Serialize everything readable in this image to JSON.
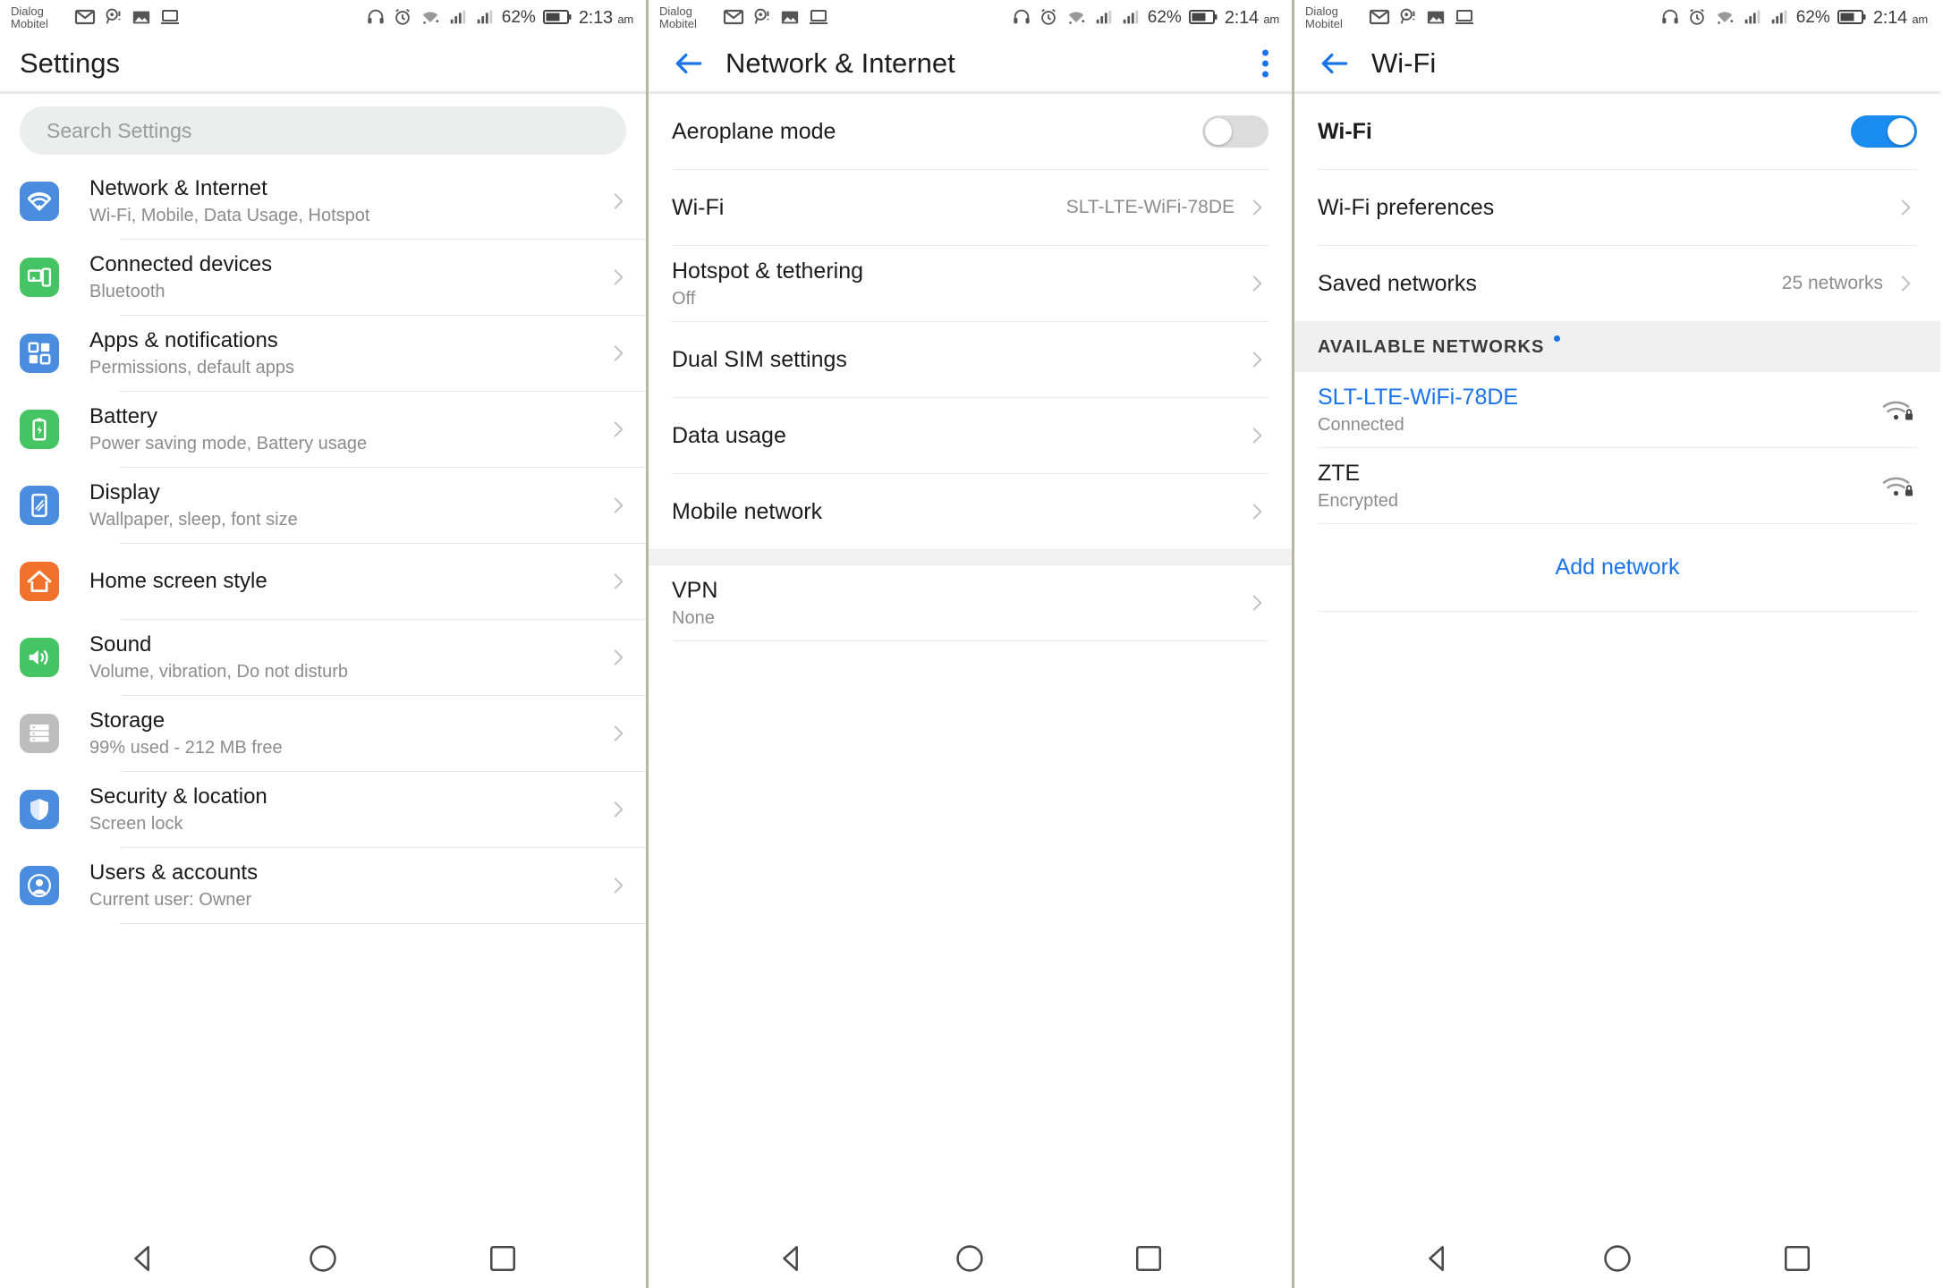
{
  "statusbar": {
    "carrier_line1": "Dialog",
    "carrier_line2": "Mobitel",
    "left_icons": [
      "gmail-icon",
      "location-alert-icon",
      "image-icon",
      "laptop-icon"
    ],
    "right_icons": [
      "headset-icon",
      "alarm-icon",
      "wifi-icon",
      "signal-sim1-icon",
      "signal-sim2-icon"
    ],
    "battery_percent": "62%",
    "time_panel1": "2:13",
    "time_panel2": "2:14",
    "time_panel3": "2:14",
    "meridiem": "am"
  },
  "panel1": {
    "title": "Settings",
    "search": {
      "placeholder": "Search Settings"
    },
    "items": [
      {
        "title": "Network & Internet",
        "subtitle": "Wi-Fi, Mobile, Data Usage, Hotspot",
        "icon": "wifi-icon",
        "color": "#4a8cde"
      },
      {
        "title": "Connected devices",
        "subtitle": "Bluetooth",
        "icon": "devices-icon",
        "color": "#45c463"
      },
      {
        "title": "Apps & notifications",
        "subtitle": "Permissions, default apps",
        "icon": "apps-icon",
        "color": "#4a8cde"
      },
      {
        "title": "Battery",
        "subtitle": "Power saving mode, Battery usage",
        "icon": "battery-icon",
        "color": "#45c463"
      },
      {
        "title": "Display",
        "subtitle": "Wallpaper, sleep, font size",
        "icon": "display-icon",
        "color": "#4a8cde"
      },
      {
        "title": "Home screen style",
        "subtitle": "",
        "icon": "home-icon",
        "color": "#f2712a"
      },
      {
        "title": "Sound",
        "subtitle": "Volume, vibration, Do not disturb",
        "icon": "sound-icon",
        "color": "#45c463"
      },
      {
        "title": "Storage",
        "subtitle": "99% used - 212 MB free",
        "icon": "storage-icon",
        "color": "#bdbdbd"
      },
      {
        "title": "Security & location",
        "subtitle": "Screen lock",
        "icon": "shield-icon",
        "color": "#4a8cde"
      },
      {
        "title": "Users & accounts",
        "subtitle": "Current user: Owner",
        "icon": "person-icon",
        "color": "#4a8cde"
      }
    ]
  },
  "panel2": {
    "title": "Network & Internet",
    "back_icon": "back-arrow-icon",
    "overflow_icon": "overflow-menu-icon",
    "group1": [
      {
        "title": "Aeroplane mode",
        "subtitle": "",
        "value": "",
        "toggle": "off",
        "chevron": false
      },
      {
        "title": "Wi-Fi",
        "subtitle": "",
        "value": "SLT-LTE-WiFi-78DE",
        "chevron": true
      },
      {
        "title": "Hotspot & tethering",
        "subtitle": "Off",
        "value": "",
        "chevron": true
      },
      {
        "title": "Dual SIM settings",
        "subtitle": "",
        "value": "",
        "chevron": true
      },
      {
        "title": "Data usage",
        "subtitle": "",
        "value": "",
        "chevron": true
      },
      {
        "title": "Mobile network",
        "subtitle": "",
        "value": "",
        "chevron": true
      }
    ],
    "group2": [
      {
        "title": "VPN",
        "subtitle": "None",
        "value": "",
        "chevron": true
      }
    ]
  },
  "panel3": {
    "title": "Wi-Fi",
    "back_icon": "back-arrow-icon",
    "group1": [
      {
        "title": "Wi-Fi",
        "subtitle": "",
        "value": "",
        "toggle": "on",
        "bold": true,
        "chevron": false
      },
      {
        "title": "Wi-Fi preferences",
        "subtitle": "",
        "value": "",
        "chevron": true
      },
      {
        "title": "Saved networks",
        "subtitle": "",
        "value": "25 networks",
        "chevron": true
      }
    ],
    "section_header": "AVAILABLE NETWORKS",
    "networks": [
      {
        "ssid": "SLT-LTE-WiFi-78DE",
        "status": "Connected",
        "blue": true,
        "icon": "wifi-lock-icon"
      },
      {
        "ssid": "ZTE",
        "status": "Encrypted",
        "blue": false,
        "icon": "wifi-lock-icon"
      }
    ],
    "add_network": "Add network"
  },
  "navbar": {
    "back": "nav-back-icon",
    "home": "nav-home-icon",
    "recents": "nav-recents-icon"
  },
  "colors": {
    "accent": "#1a73e8",
    "toggle_on": "#1a8cf0"
  }
}
